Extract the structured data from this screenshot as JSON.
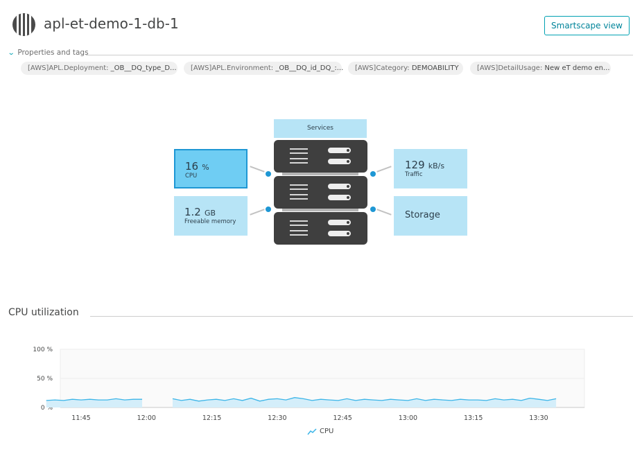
{
  "header": {
    "title": "apl-et-demo-1-db-1",
    "icon": "database-server-icon",
    "smartscape_label": "Smartscape view",
    "accent": "#00a1b2"
  },
  "properties": {
    "label": "Properties and tags",
    "tags": [
      {
        "key": "[AWS]APL.Deployment: ",
        "value": "_OB__DQ_type_D..."
      },
      {
        "key": "[AWS]APL.Environment: ",
        "value": "_OB__DQ_id_DQ_:..."
      },
      {
        "key": "[AWS]Category: ",
        "value": "DEMOABILITY"
      },
      {
        "key": "[AWS]DetailUsage: ",
        "value": "New eT demo en..."
      }
    ]
  },
  "infographic": {
    "cpu": {
      "value": "16",
      "unit": "%",
      "label": "CPU"
    },
    "memory": {
      "value": "1.2",
      "unit": "GB",
      "label": "Freeable memory"
    },
    "traffic": {
      "value": "129",
      "unit": "kB/s",
      "label": "Traffic"
    },
    "storage": {
      "label": "Storage"
    },
    "services": {
      "label": "Services"
    },
    "colors": {
      "selected": "#6fcdf3",
      "tile": "#b7e4f6",
      "dot": "#1e97d4"
    }
  },
  "cpu_section": {
    "heading": "CPU utilization",
    "legend": "CPU"
  },
  "chart_data": {
    "type": "area",
    "title": "CPU utilization",
    "ylabel": "",
    "xlabel": "",
    "ylim": [
      0,
      100
    ],
    "yticks": [
      "100 %",
      "50 %",
      "0 %"
    ],
    "xticks": [
      "11:45",
      "12:00",
      "12:15",
      "12:30",
      "12:45",
      "13:00",
      "13:15",
      "13:30"
    ],
    "grid": true,
    "legend_position": "bottom",
    "series": [
      {
        "name": "CPU",
        "color": "#3cb5e8",
        "segments": [
          {
            "x": [
              "11:37",
              "11:39",
              "11:41",
              "11:43",
              "11:45",
              "11:47",
              "11:49",
              "11:51",
              "11:53",
              "11:55",
              "11:57",
              "11:59"
            ],
            "y": [
              12,
              13,
              12,
              14,
              13,
              14,
              13,
              13,
              15,
              13,
              14,
              14
            ]
          },
          {
            "x": [
              "12:06",
              "12:08",
              "12:10",
              "12:12",
              "12:14",
              "12:16",
              "12:18",
              "12:20",
              "12:22",
              "12:24",
              "12:26",
              "12:28",
              "12:30",
              "12:32",
              "12:34",
              "12:36",
              "12:38",
              "12:40",
              "12:42",
              "12:44",
              "12:46",
              "12:48",
              "12:50",
              "12:52",
              "12:54",
              "12:56",
              "12:58",
              "13:00",
              "13:02",
              "13:04",
              "13:06",
              "13:08",
              "13:10",
              "13:12",
              "13:14",
              "13:16",
              "13:18",
              "13:20",
              "13:22",
              "13:24",
              "13:26",
              "13:28",
              "13:30",
              "13:32",
              "13:34"
            ],
            "y": [
              15,
              12,
              14,
              11,
              13,
              14,
              12,
              15,
              12,
              16,
              11,
              14,
              15,
              13,
              17,
              15,
              12,
              14,
              13,
              12,
              15,
              12,
              14,
              13,
              12,
              14,
              13,
              12,
              15,
              12,
              14,
              13,
              12,
              14,
              13,
              13,
              12,
              15,
              13,
              14,
              12,
              16,
              14,
              12,
              15
            ]
          }
        ]
      }
    ]
  }
}
